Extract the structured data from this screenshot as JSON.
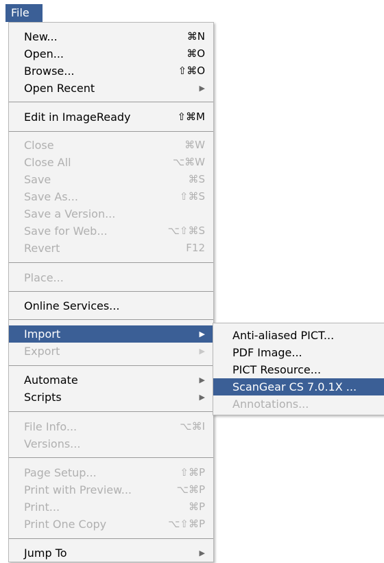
{
  "menu_title": "File",
  "menu": {
    "items": [
      {
        "label": "New...",
        "shortcut": "⌘N",
        "enabled": true
      },
      {
        "label": "Open...",
        "shortcut": "⌘O",
        "enabled": true
      },
      {
        "label": "Browse...",
        "shortcut": "⇧⌘O",
        "enabled": true
      },
      {
        "label": "Open Recent",
        "submenu_arrow": "▶",
        "enabled": true
      },
      {
        "label": "Edit in ImageReady",
        "shortcut": "⇧⌘M",
        "enabled": true
      },
      {
        "label": "Close",
        "shortcut": "⌘W",
        "enabled": false
      },
      {
        "label": "Close All",
        "shortcut": "⌥⌘W",
        "enabled": false
      },
      {
        "label": "Save",
        "shortcut": "⌘S",
        "enabled": false
      },
      {
        "label": "Save As...",
        "shortcut": "⇧⌘S",
        "enabled": false
      },
      {
        "label": "Save a Version...",
        "enabled": false
      },
      {
        "label": "Save for Web...",
        "shortcut": "⌥⇧⌘S",
        "enabled": false
      },
      {
        "label": "Revert",
        "shortcut": "F12",
        "enabled": false
      },
      {
        "label": "Place...",
        "enabled": false
      },
      {
        "label": "Online Services...",
        "enabled": true
      },
      {
        "label": "Import",
        "submenu_arrow": "▶",
        "enabled": true,
        "highlighted": true
      },
      {
        "label": "Export",
        "submenu_arrow": "▶",
        "enabled": false
      },
      {
        "label": "Automate",
        "submenu_arrow": "▶",
        "enabled": true
      },
      {
        "label": "Scripts",
        "submenu_arrow": "▶",
        "enabled": true
      },
      {
        "label": "File Info...",
        "shortcut": "⌥⌘I",
        "enabled": false
      },
      {
        "label": "Versions...",
        "enabled": false
      },
      {
        "label": "Page Setup...",
        "shortcut": "⇧⌘P",
        "enabled": false
      },
      {
        "label": "Print with Preview...",
        "shortcut": "⌥⌘P",
        "enabled": false
      },
      {
        "label": "Print...",
        "shortcut": "⌘P",
        "enabled": false
      },
      {
        "label": "Print One Copy",
        "shortcut": "⌥⇧⌘P",
        "enabled": false
      },
      {
        "label": "Jump To",
        "submenu_arrow": "▶",
        "enabled": true
      }
    ]
  },
  "import_submenu": {
    "items": [
      {
        "label": "Anti-aliased PICT...",
        "enabled": true
      },
      {
        "label": "PDF Image...",
        "enabled": true
      },
      {
        "label": "PICT Resource...",
        "enabled": true
      },
      {
        "label": "ScanGear CS 7.0.1X ...",
        "enabled": true,
        "highlighted": true
      },
      {
        "label": "Annotations...",
        "enabled": false
      }
    ]
  },
  "colors": {
    "highlight": "#3b5f96",
    "menu_background": "#f3f3f3",
    "disabled_text": "#b0b0b0"
  }
}
